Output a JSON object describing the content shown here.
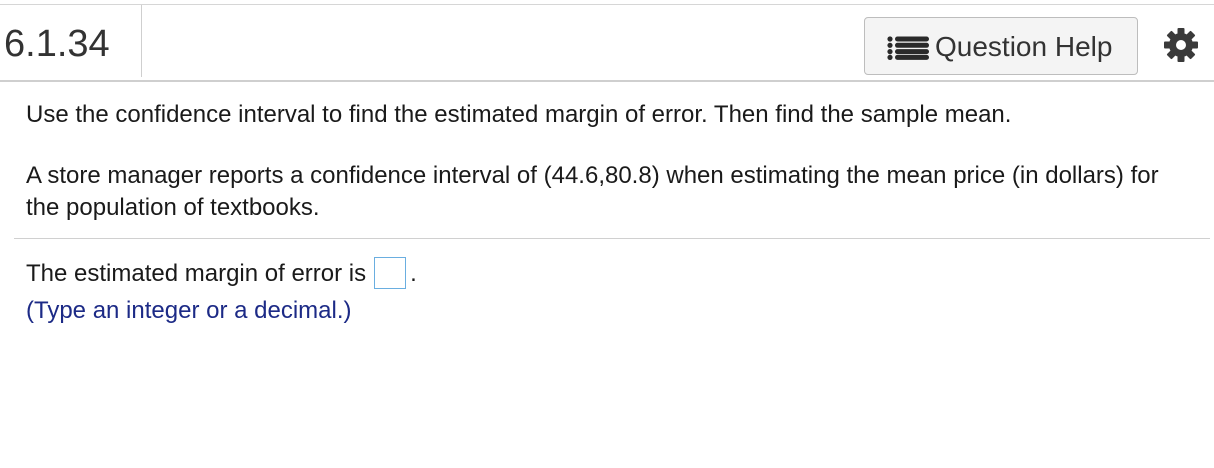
{
  "header": {
    "question_number": "6.1.34",
    "help_button_label": "Question Help",
    "help_icon": "list-icon",
    "settings_icon": "gear-icon"
  },
  "content": {
    "instruction": "Use the confidence interval to find the estimated margin of error. Then find the sample mean.",
    "problem": "A store manager reports a confidence interval of (44.6,80.8) when estimating the mean price (in dollars) for the population of textbooks.",
    "answer_prompt": "The estimated margin of error is",
    "answer_suffix": ".",
    "answer_value": "",
    "hint": "(Type an integer or a decimal.)"
  },
  "colors": {
    "hint_text": "#1c2a86",
    "input_border": "#6aaee0"
  }
}
